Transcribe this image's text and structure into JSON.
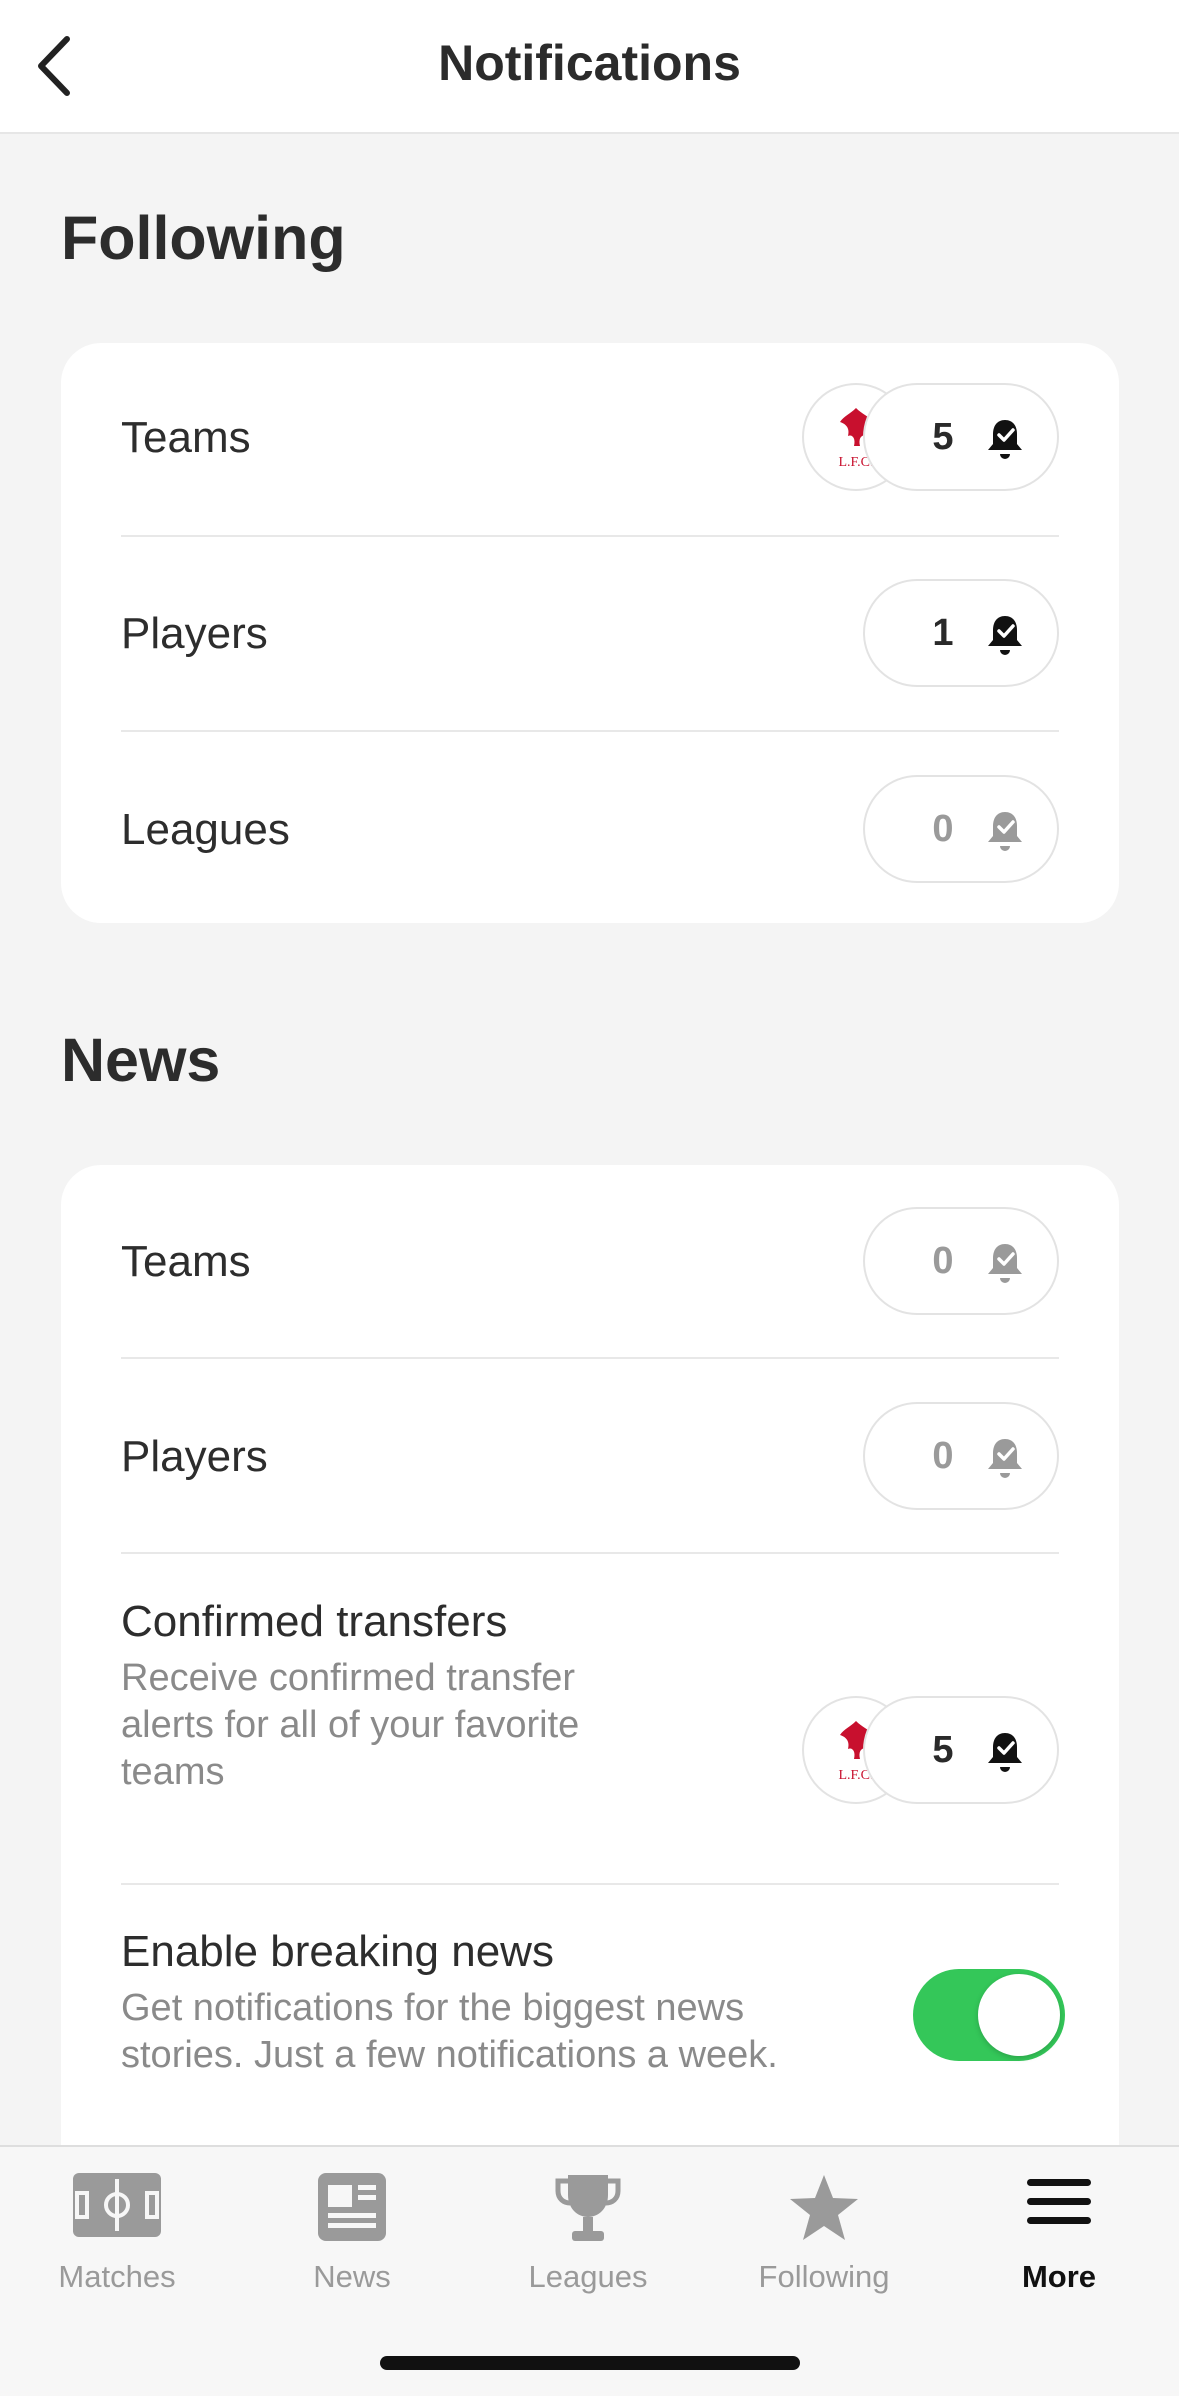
{
  "header": {
    "title": "Notifications",
    "back_icon": "chevron-left-icon"
  },
  "following": {
    "title": "Following",
    "rows": [
      {
        "label": "Teams",
        "count": "5",
        "state": "active",
        "avatars": [
          "liverpool-crest",
          "psg-crest"
        ]
      },
      {
        "label": "Players",
        "count": "1",
        "state": "active",
        "avatars": [
          "player-photo"
        ]
      },
      {
        "label": "Leagues",
        "count": "0",
        "state": "inactive",
        "avatars": []
      }
    ]
  },
  "news": {
    "title": "News",
    "rows": [
      {
        "label": "Teams",
        "count": "0",
        "state": "inactive"
      },
      {
        "label": "Players",
        "count": "0",
        "state": "inactive"
      },
      {
        "label": "Confirmed transfers",
        "description": "Receive confirmed transfer alerts for all of your favorite teams",
        "count": "5",
        "state": "active",
        "avatars": [
          "liverpool-crest",
          "psg-crest"
        ]
      },
      {
        "label": "Enable breaking news",
        "description": "Get notifications for the biggest news stories. Just a few notifications a week.",
        "toggle": true
      }
    ]
  },
  "colors": {
    "accent_green": "#34c759",
    "liverpool_red": "#c8102e",
    "psg_blue": "#004170"
  },
  "tabbar": {
    "tabs": [
      {
        "label": "Matches",
        "icon": "pitch-icon",
        "active": false
      },
      {
        "label": "News",
        "icon": "newspaper-icon",
        "active": false
      },
      {
        "label": "Leagues",
        "icon": "trophy-icon",
        "active": false
      },
      {
        "label": "Following",
        "icon": "star-icon",
        "active": false
      },
      {
        "label": "More",
        "icon": "menu-icon",
        "active": true
      }
    ]
  }
}
